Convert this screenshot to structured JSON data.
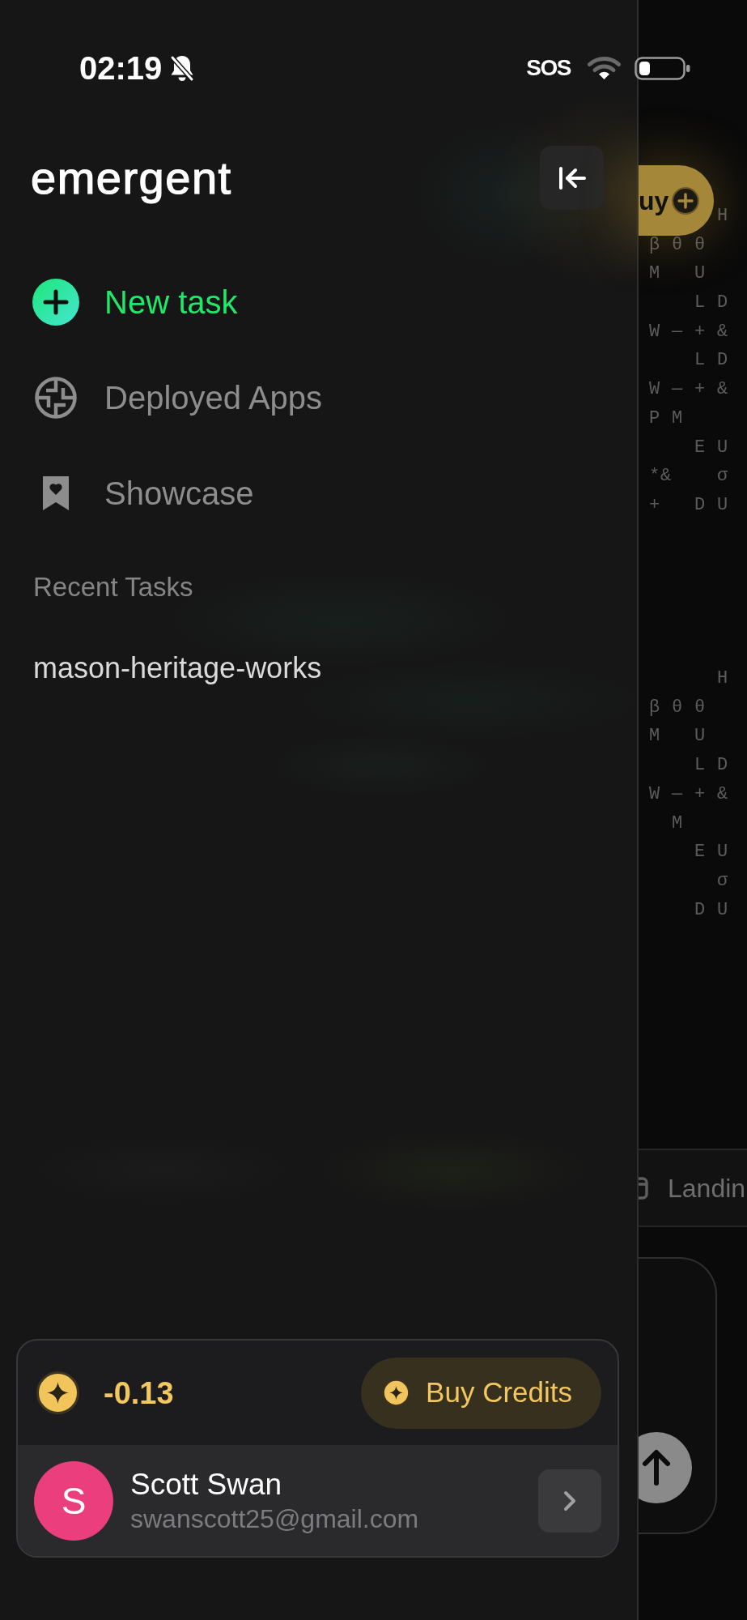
{
  "status_bar": {
    "time": "02:19",
    "carrier": "SOS"
  },
  "drawer": {
    "logo": "emergent",
    "nav_items": [
      {
        "kind": "action",
        "label": "New task"
      },
      {
        "kind": "link",
        "label": "Deployed Apps"
      },
      {
        "kind": "link",
        "label": "Showcase"
      }
    ],
    "recent_tasks": {
      "heading": "Recent Tasks",
      "items": [
        {
          "title": "mason-heritage-works"
        }
      ]
    },
    "account": {
      "credits": "-0.13",
      "buy_button": "Buy Credits",
      "user": {
        "initial": "S",
        "name": "Scott Swan",
        "email": "swanscott25@gmail.com"
      }
    }
  },
  "background_page": {
    "button_label": "uy",
    "glyph_blocks": [
      [
        "      H",
        "β θ θ",
        "M   U",
        "    L D",
        "W — + &",
        "    L D",
        "W — + &",
        "P M",
        "    E U",
        "*&    σ",
        "+   D U"
      ],
      [
        "      H",
        "β θ θ",
        "M   U",
        "    L D",
        "W — + &",
        "  M",
        "    E U",
        "      σ",
        "    D U"
      ]
    ],
    "tab_label": "Landin"
  }
}
